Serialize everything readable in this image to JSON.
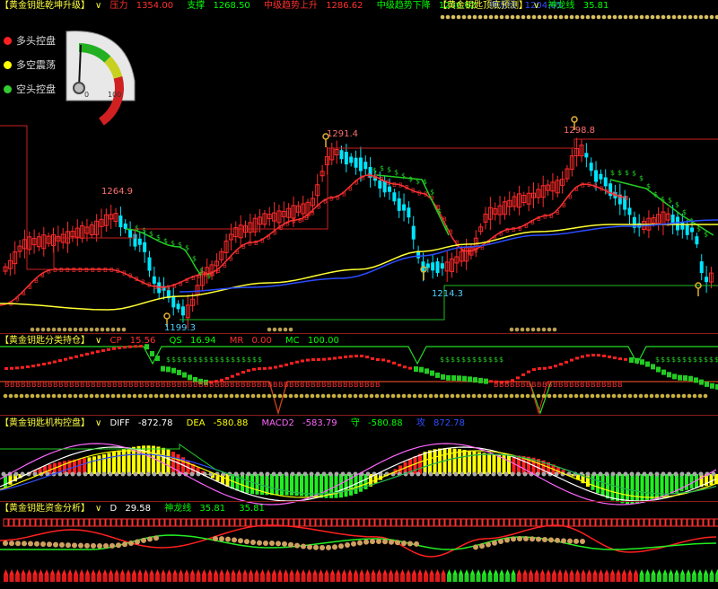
{
  "main_header": {
    "title": "【黄金钥匙乾坤升级】",
    "items": [
      {
        "label": "压力",
        "value": "1354.00",
        "color": "#ff3030"
      },
      {
        "label": "支撑",
        "value": "1268.50",
        "color": "#00ff00"
      },
      {
        "label": "中级趋势上升",
        "value": "1286.62",
        "color": "#ff3030"
      },
      {
        "label": "中级趋势下降",
        "value": "1286.62",
        "color": "#00ff00"
      },
      {
        "label": "神龙线",
        "value": "1204.65",
        "color": "#3050ff"
      }
    ],
    "right_title": "【黄金钥匙顶底预测】",
    "right_item": {
      "label": "神龙线",
      "value": "35.81",
      "color": "#00ff00"
    }
  },
  "legend": [
    {
      "label": "多头控盘",
      "color": "#ff2020"
    },
    {
      "label": "多空震荡",
      "color": "#ffff00"
    },
    {
      "label": "空头控盘",
      "color": "#33cc33"
    }
  ],
  "gauge": {
    "min_label": "0",
    "max_label": "100",
    "level": 0.12
  },
  "price_labels": {
    "high1": "1264.9",
    "high2": "1291.4",
    "high3": "1298.8",
    "low1": "1199.3",
    "low2": "1214.3"
  },
  "panel2_header": {
    "title": "【黄金钥匙分类持仓】",
    "items": [
      {
        "label": "CP",
        "value": "15.56",
        "color": "#ff3030"
      },
      {
        "label": "QS",
        "value": "16.94",
        "color": "#00ff00"
      },
      {
        "label": "MR",
        "value": "0.00",
        "color": "#ff3030"
      },
      {
        "label": "MC",
        "value": "100.00",
        "color": "#00ff00"
      }
    ]
  },
  "panel3_header": {
    "title": "【黄金钥匙机构控盘】",
    "items": [
      {
        "label": "DIFF",
        "value": "-872.78",
        "color": "#ffffff"
      },
      {
        "label": "DEA",
        "value": "-580.88",
        "color": "#ffff00"
      },
      {
        "label": "MACD2",
        "value": "-583.79",
        "color": "#ff66ff"
      },
      {
        "label": "守",
        "value": "-580.88",
        "color": "#00ff00"
      },
      {
        "label": "攻",
        "value": "872.78",
        "color": "#3050ff"
      }
    ]
  },
  "panel4_header": {
    "title": "【黄金钥匙资金分析】",
    "items": [
      {
        "label": "D",
        "value": "29.58",
        "color": "#ffffff"
      },
      {
        "label": "神龙线",
        "value": "35.81",
        "color": "#00ff00"
      },
      {
        "label": "",
        "value": "35.81",
        "color": "#00ff00"
      }
    ]
  },
  "colors": {
    "up": "#ff2a2a",
    "down": "#00e5ff",
    "ma_red": "#ff3030",
    "ma_green": "#22cc22",
    "ma_yellow": "#ffff33",
    "ma_blue": "#2a4cff"
  }
}
